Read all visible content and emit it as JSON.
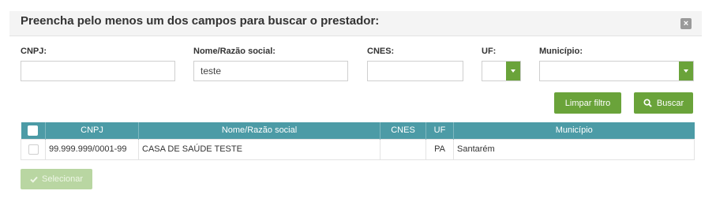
{
  "header": {
    "title": "Preencha pelo menos um dos campos para buscar o prestador:",
    "close_symbol": "×"
  },
  "filters": {
    "cnpj": {
      "label": "CNPJ:",
      "value": ""
    },
    "nome": {
      "label": "Nome/Razão social:",
      "value": "teste"
    },
    "cnes": {
      "label": "CNES:",
      "value": ""
    },
    "uf": {
      "label": "UF:",
      "value": ""
    },
    "municipio": {
      "label": "Município:",
      "value": ""
    }
  },
  "buttons": {
    "limpar": "Limpar filtro",
    "buscar": "Buscar",
    "selecionar": "Selecionar"
  },
  "icons": {
    "search": "search-icon",
    "check": "check-icon",
    "close": "close-icon",
    "dropdown": "chevron-down-icon"
  },
  "table": {
    "columns": [
      "CNPJ",
      "Nome/Razão social",
      "CNES",
      "UF",
      "Município"
    ],
    "rows": [
      {
        "cnpj": "99.999.999/0001-99",
        "nome": "CASA DE SAÚDE TESTE",
        "cnes": "",
        "uf": "PA",
        "municipio": "Santarém"
      }
    ]
  },
  "colors": {
    "accent_green": "#6aa33a",
    "disabled_green": "#b9d6a2",
    "table_header": "#4c9ba6"
  }
}
